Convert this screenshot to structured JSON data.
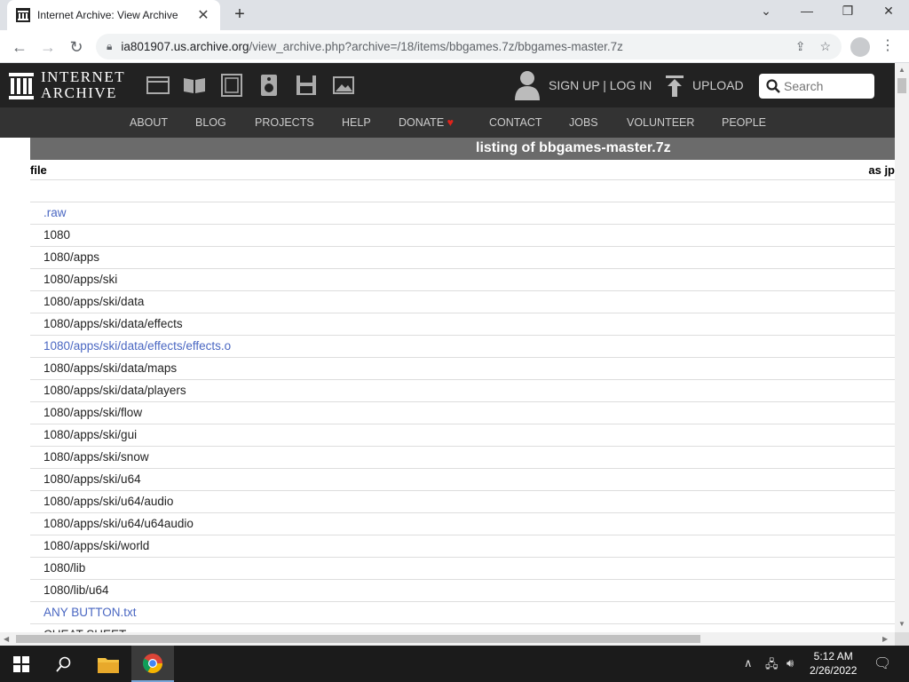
{
  "browser": {
    "tab_title": "Internet Archive: View Archive",
    "url_host": "ia801907.us.archive.org",
    "url_path": "/view_archive.php?archive=/18/items/bbgames.7z/bbgames-master.7z"
  },
  "ia_header": {
    "logo_line1": "INTERNET",
    "logo_line2": "ARCHIVE",
    "signup_label": "SIGN UP | LOG IN",
    "upload_label": "UPLOAD",
    "search_placeholder": "Search",
    "media_icons": [
      "web-icon",
      "texts-icon",
      "video-icon",
      "audio-icon",
      "software-icon",
      "images-icon"
    ]
  },
  "ia_nav": {
    "items": [
      "ABOUT",
      "BLOG",
      "PROJECTS",
      "HELP",
      "DONATE",
      "CONTACT",
      "JOBS",
      "VOLUNTEER",
      "PEOPLE"
    ],
    "donate_heart": "♥"
  },
  "listing": {
    "title": "listing of bbgames-master.7z",
    "col_file": "file",
    "col_asjpg": "as jp",
    "rows": [
      {
        "text": ".raw",
        "link": true
      },
      {
        "text": "1080",
        "link": false
      },
      {
        "text": "1080/apps",
        "link": false
      },
      {
        "text": "1080/apps/ski",
        "link": false
      },
      {
        "text": "1080/apps/ski/data",
        "link": false
      },
      {
        "text": "1080/apps/ski/data/effects",
        "link": false
      },
      {
        "text": "1080/apps/ski/data/effects/effects.o",
        "link": true
      },
      {
        "text": "1080/apps/ski/data/maps",
        "link": false
      },
      {
        "text": "1080/apps/ski/data/players",
        "link": false
      },
      {
        "text": "1080/apps/ski/flow",
        "link": false
      },
      {
        "text": "1080/apps/ski/gui",
        "link": false
      },
      {
        "text": "1080/apps/ski/snow",
        "link": false
      },
      {
        "text": "1080/apps/ski/u64",
        "link": false
      },
      {
        "text": "1080/apps/ski/u64/audio",
        "link": false
      },
      {
        "text": "1080/apps/ski/u64/u64audio",
        "link": false
      },
      {
        "text": "1080/apps/ski/world",
        "link": false
      },
      {
        "text": "1080/lib",
        "link": false
      },
      {
        "text": "1080/lib/u64",
        "link": false
      },
      {
        "text": "ANY BUTTON.txt",
        "link": true
      },
      {
        "text": "CHEAT SHEET",
        "link": false
      }
    ]
  },
  "taskbar": {
    "time": "5:12 AM",
    "date": "2/26/2022"
  },
  "colors": {
    "link": "#4a67c2",
    "ia_header_bg": "#222222",
    "ia_nav_bg": "#333333",
    "listing_title_bg": "#6b6b6b"
  }
}
